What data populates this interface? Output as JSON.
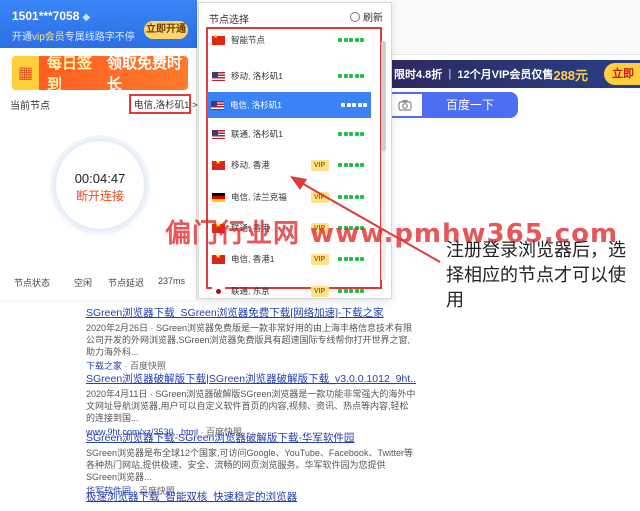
{
  "client": {
    "user": "1501***7058",
    "vip_prefix": "开通",
    "vip_word": "vip会员",
    "vip_suffix": "专属线路字不停",
    "open_button": "立即开通",
    "banner_part1": "每日签到",
    "banner_part2": "领取免费时长",
    "current_node_label": "当前节点",
    "current_node_value": "电信,洛杉矶1",
    "current_node_chevron": ">",
    "timer": "00:04:47",
    "disconnect": "断开连接",
    "stats": {
      "status_label": "节点状态",
      "status_value": "空闲",
      "latency_label": "节点延迟",
      "latency_value": "237ms"
    }
  },
  "popup": {
    "title": "节点选择",
    "refresh": "刷新",
    "nodes": [
      {
        "name": "智能节点",
        "flag": "cn",
        "vip": false,
        "signal": 5,
        "selected": false
      },
      {
        "name": "移动, 洛杉矶1",
        "flag": "us",
        "vip": false,
        "signal": 5,
        "selected": false
      },
      {
        "name": "电信, 洛杉矶1",
        "flag": "us",
        "vip": false,
        "signal": 5,
        "selected": true
      },
      {
        "name": "联通, 洛杉矶1",
        "flag": "us",
        "vip": false,
        "signal": 5,
        "selected": false
      },
      {
        "name": "移动, 香港",
        "flag": "vn",
        "vip": true,
        "signal": 5,
        "selected": false
      },
      {
        "name": "电信, 法兰克福",
        "flag": "de",
        "vip": true,
        "signal": 5,
        "selected": false
      },
      {
        "name": "联通, 香港",
        "flag": "vn",
        "vip": true,
        "signal": 5,
        "selected": false
      },
      {
        "name": "电信, 香港1",
        "flag": "vn",
        "vip": true,
        "signal": 5,
        "selected": false
      },
      {
        "name": "联通, 东京",
        "flag": "jp",
        "vip": true,
        "signal": 5,
        "selected": false
      }
    ],
    "vip_badge": "VIP"
  },
  "browser": {
    "promo_limited": "限时4.8折",
    "promo_sep": "|",
    "promo_vip": "12个月VIP会员仅售",
    "promo_price": "288元",
    "promo_button": "立即",
    "search_button": "百度一下",
    "results": [
      {
        "title": "SGreen浏览器下载_SGreen浏览器免费下载[网络加速]-下载之家",
        "desc": "2020年2月26日 · SGreen浏览器免费版是一款非常好用的由上海丰格信息技术有限公司开发的外网浏览器,SGreen浏览器免费版具有超速国际专线帮你打开世界之窗,助力海外科...",
        "source": "下载之家",
        "snapshot": "百度快照"
      },
      {
        "title": "SGreen浏览器破解版下载|SGreen浏览器破解版下载_v3.0.0.1012_9ht...",
        "desc": "2020年4月11日 · SGreen浏览器破解版SGreen浏览器是一款功能非常强大的海外中文网址导航浏览器,用户可以自定义软件首页的内容,视频、资讯、热点等内容,轻松的连接到国...",
        "source": "www.9ht.com/xz/3530...html",
        "snapshot": "百度快照"
      },
      {
        "title": "SGreen浏览器下载-SGreen浏览器破解版下载-华军软件园",
        "desc": "SGreen浏览器是布全球12个国家,可访问Google、YouTube、Facebook、Twitter等各种热门网站,提供极速、安全、流畅的网页浏览服务。华军软件园为您提供SGreen浏览器...",
        "source": "华军软件园",
        "snapshot": "百度快照"
      },
      {
        "title": "极速浏览器下载_智能双核_快速稳定的浏览器",
        "desc": "",
        "source": "",
        "snapshot": ""
      }
    ]
  },
  "annotation": {
    "text": "注册登录浏览器后，选择相应的节点才可以使用"
  },
  "watermark": "偏门行业网 www.pmhw365.com",
  "colors": {
    "accent_blue": "#3b82f6",
    "annotation_red": "#e03b3b",
    "signal_green": "#1fbf4a",
    "vip_gold": "#ffe28a"
  }
}
